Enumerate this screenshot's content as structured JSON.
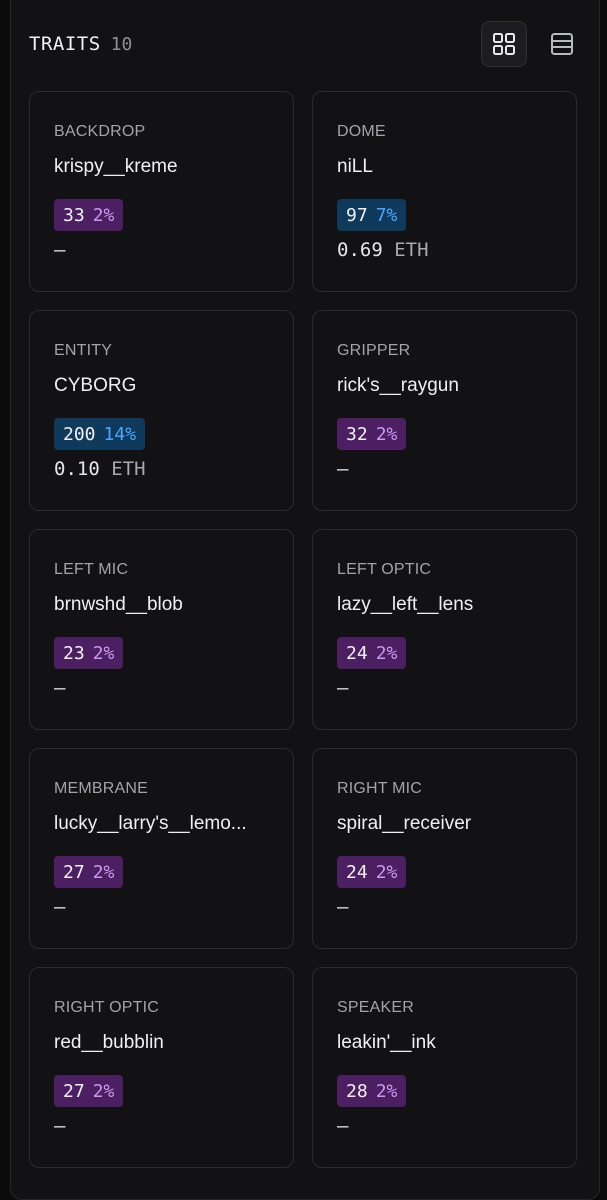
{
  "header": {
    "title": "TRAITS",
    "count": "10",
    "grid_view_icon": "grid-view-icon",
    "list_view_icon": "list-view-icon"
  },
  "colors": {
    "background": "#121214",
    "card_border": "#2b2b30",
    "badge_purple_bg": "#4b1f62",
    "badge_purple_text": "#c79af0",
    "badge_blue_bg": "#0f3a5c",
    "badge_blue_text": "#4aa6ff"
  },
  "traits": [
    {
      "type": "BACKDROP",
      "value": "krispy__kreme",
      "count": "33",
      "percent": "2%",
      "badge_color": "purple",
      "price": "–",
      "price_unit": ""
    },
    {
      "type": "DOME",
      "value": "niLL",
      "count": "97",
      "percent": "7%",
      "badge_color": "blue",
      "price": "0.69",
      "price_unit": "ETH"
    },
    {
      "type": "ENTITY",
      "value": "CYBORG",
      "count": "200",
      "percent": "14%",
      "badge_color": "blue",
      "price": "0.10",
      "price_unit": "ETH"
    },
    {
      "type": "GRIPPER",
      "value": "rick's__raygun",
      "count": "32",
      "percent": "2%",
      "badge_color": "purple",
      "price": "–",
      "price_unit": ""
    },
    {
      "type": "LEFT MIC",
      "value": "brnwshd__blob",
      "count": "23",
      "percent": "2%",
      "badge_color": "purple",
      "price": "–",
      "price_unit": ""
    },
    {
      "type": "LEFT OPTIC",
      "value": "lazy__left__lens",
      "count": "24",
      "percent": "2%",
      "badge_color": "purple",
      "price": "–",
      "price_unit": ""
    },
    {
      "type": "MEMBRANE",
      "value": "lucky__larry's__lemo...",
      "count": "27",
      "percent": "2%",
      "badge_color": "purple",
      "price": "–",
      "price_unit": ""
    },
    {
      "type": "RIGHT MIC",
      "value": "spiral__receiver",
      "count": "24",
      "percent": "2%",
      "badge_color": "purple",
      "price": "–",
      "price_unit": ""
    },
    {
      "type": "RIGHT OPTIC",
      "value": "red__bubblin",
      "count": "27",
      "percent": "2%",
      "badge_color": "purple",
      "price": "–",
      "price_unit": ""
    },
    {
      "type": "SPEAKER",
      "value": "leakin'__ink",
      "count": "28",
      "percent": "2%",
      "badge_color": "purple",
      "price": "–",
      "price_unit": ""
    }
  ]
}
